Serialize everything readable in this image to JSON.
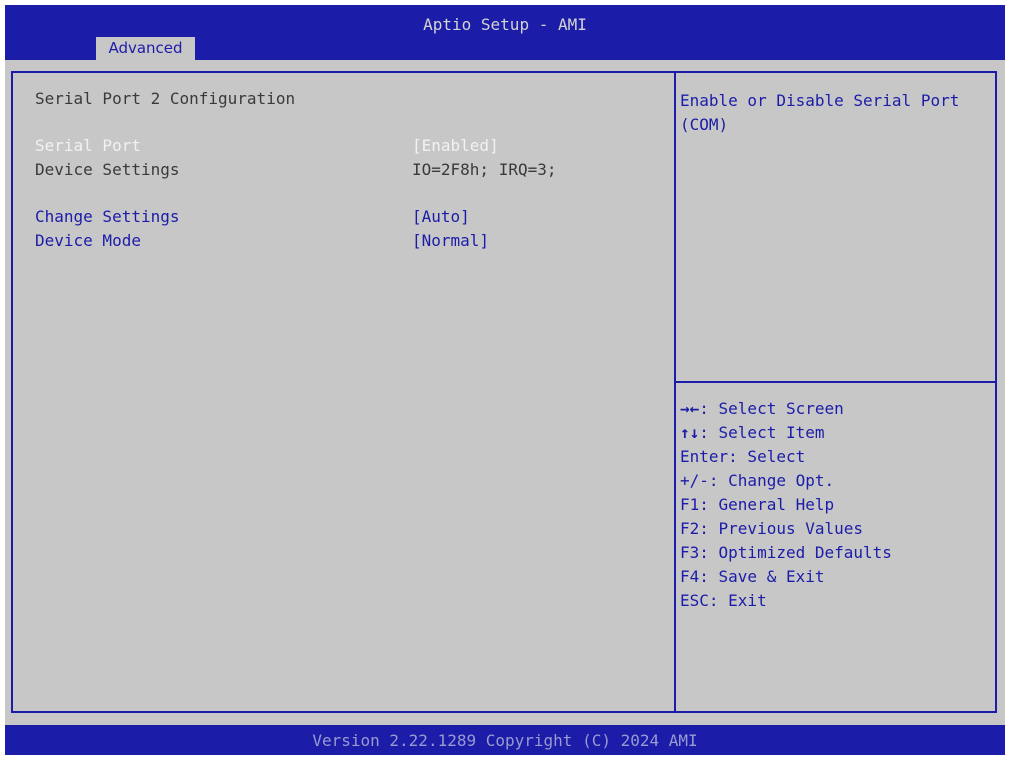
{
  "header": {
    "title": "Aptio Setup - AMI",
    "active_tab": "Advanced"
  },
  "main": {
    "section_title": "Serial Port 2 Configuration",
    "rows": [
      {
        "label": "Serial Port",
        "value": "[Enabled]"
      },
      {
        "label": "Device Settings",
        "value": "IO=2F8h; IRQ=3;"
      },
      {
        "label": "Change Settings",
        "value": "[Auto]"
      },
      {
        "label": "Device Mode",
        "value": "[Normal]"
      }
    ]
  },
  "help": {
    "text": "Enable or Disable Serial Port (COM)"
  },
  "keys": [
    {
      "key": "→←",
      "desc": ": Select Screen"
    },
    {
      "key": "↑↓",
      "desc": ": Select Item"
    },
    {
      "key": "",
      "desc": "Enter: Select"
    },
    {
      "key": "",
      "desc": "+/-: Change Opt."
    },
    {
      "key": "",
      "desc": "F1: General Help"
    },
    {
      "key": "",
      "desc": "F2: Previous Values"
    },
    {
      "key": "",
      "desc": "F3: Optimized Defaults"
    },
    {
      "key": "",
      "desc": "F4: Save & Exit"
    },
    {
      "key": "",
      "desc": "ESC: Exit"
    }
  ],
  "footer": {
    "version": "Version 2.22.1289 Copyright (C) 2024 AMI"
  },
  "colors": {
    "bar_blue": "#1b1ca8",
    "panel_gray": "#c7c7c7",
    "selected_white": "#f2f2f2"
  }
}
